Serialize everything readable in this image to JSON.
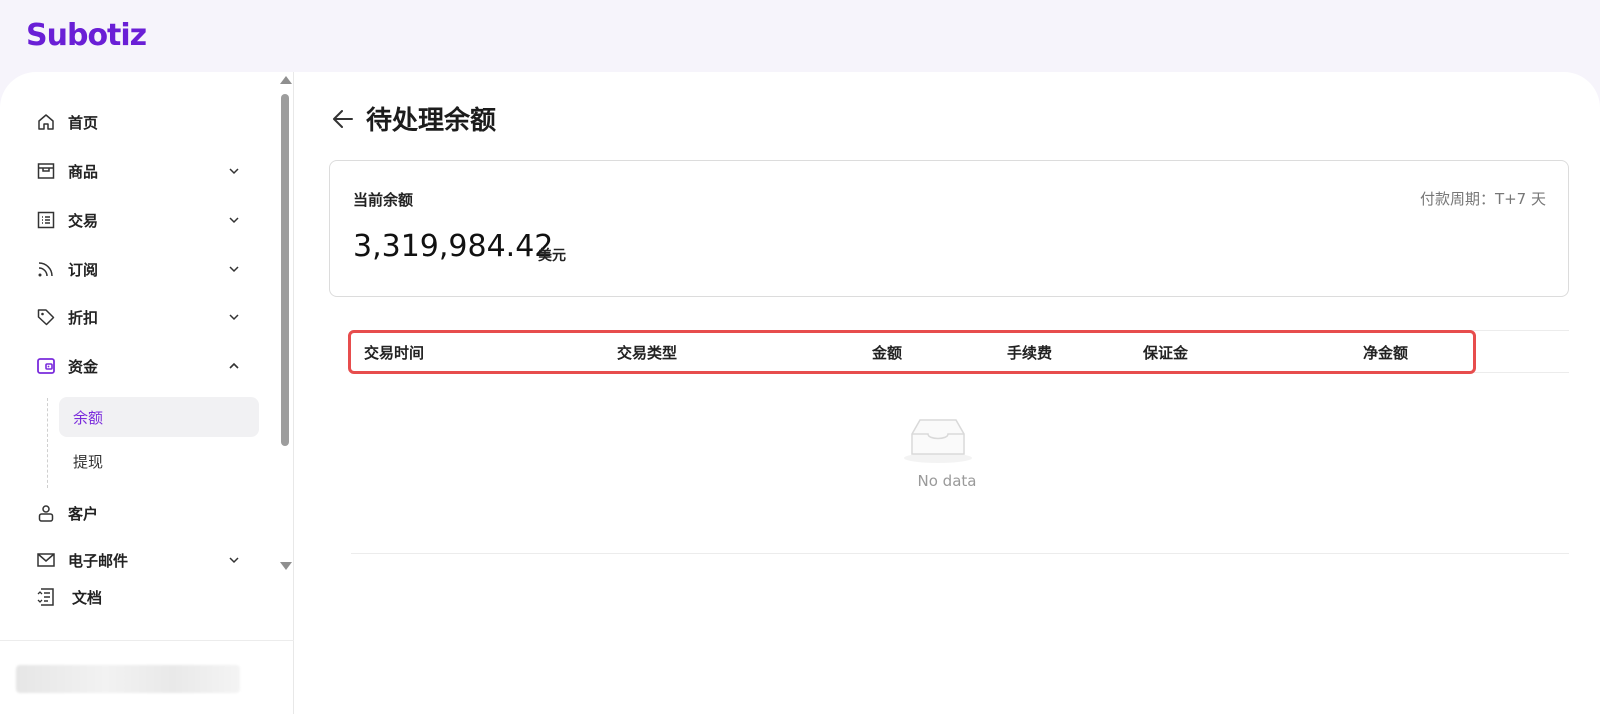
{
  "brand": {
    "logo": "Subotiz"
  },
  "sidebar": {
    "items": [
      {
        "label": "首页",
        "icon": "home-icon"
      },
      {
        "label": "商品",
        "icon": "store-icon"
      },
      {
        "label": "交易",
        "icon": "list-icon"
      },
      {
        "label": "订阅",
        "icon": "rss-icon"
      },
      {
        "label": "折扣",
        "icon": "tag-icon"
      },
      {
        "label": "资金",
        "icon": "wallet-icon",
        "expanded": true
      },
      {
        "label": "客户",
        "icon": "user-icon"
      },
      {
        "label": "电子邮件",
        "icon": "mail-icon"
      }
    ],
    "sub_items": [
      {
        "label": "余额",
        "active": true
      },
      {
        "label": "提现",
        "active": false
      }
    ],
    "docs_label": "文档"
  },
  "page": {
    "title": "待处理余额",
    "card": {
      "label": "当前余额",
      "cycle": "付款周期：T+7 天",
      "amount": "3,319,984.42",
      "unit": "美元"
    },
    "table": {
      "headers": [
        "交易时间",
        "交易类型",
        "金额",
        "手续费",
        "保证金",
        "净金额"
      ],
      "empty_text": "No data"
    }
  },
  "colors": {
    "accent": "#7a2bdc",
    "highlight": "#e74d4d"
  }
}
